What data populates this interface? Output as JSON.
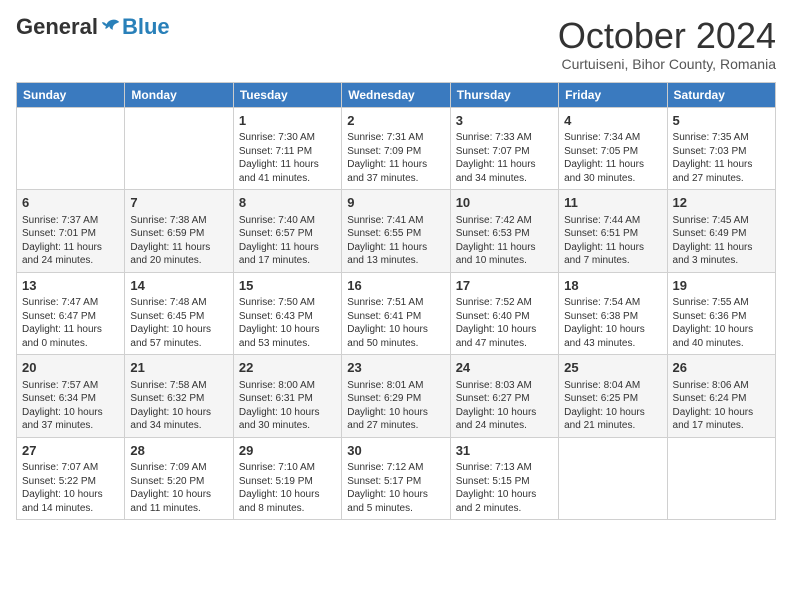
{
  "logo": {
    "general": "General",
    "blue": "Blue"
  },
  "header": {
    "month": "October 2024",
    "location": "Curtuiseni, Bihor County, Romania"
  },
  "days_of_week": [
    "Sunday",
    "Monday",
    "Tuesday",
    "Wednesday",
    "Thursday",
    "Friday",
    "Saturday"
  ],
  "weeks": [
    [
      {
        "day": "",
        "info": ""
      },
      {
        "day": "",
        "info": ""
      },
      {
        "day": "1",
        "info": "Sunrise: 7:30 AM\nSunset: 7:11 PM\nDaylight: 11 hours and 41 minutes."
      },
      {
        "day": "2",
        "info": "Sunrise: 7:31 AM\nSunset: 7:09 PM\nDaylight: 11 hours and 37 minutes."
      },
      {
        "day": "3",
        "info": "Sunrise: 7:33 AM\nSunset: 7:07 PM\nDaylight: 11 hours and 34 minutes."
      },
      {
        "day": "4",
        "info": "Sunrise: 7:34 AM\nSunset: 7:05 PM\nDaylight: 11 hours and 30 minutes."
      },
      {
        "day": "5",
        "info": "Sunrise: 7:35 AM\nSunset: 7:03 PM\nDaylight: 11 hours and 27 minutes."
      }
    ],
    [
      {
        "day": "6",
        "info": "Sunrise: 7:37 AM\nSunset: 7:01 PM\nDaylight: 11 hours and 24 minutes."
      },
      {
        "day": "7",
        "info": "Sunrise: 7:38 AM\nSunset: 6:59 PM\nDaylight: 11 hours and 20 minutes."
      },
      {
        "day": "8",
        "info": "Sunrise: 7:40 AM\nSunset: 6:57 PM\nDaylight: 11 hours and 17 minutes."
      },
      {
        "day": "9",
        "info": "Sunrise: 7:41 AM\nSunset: 6:55 PM\nDaylight: 11 hours and 13 minutes."
      },
      {
        "day": "10",
        "info": "Sunrise: 7:42 AM\nSunset: 6:53 PM\nDaylight: 11 hours and 10 minutes."
      },
      {
        "day": "11",
        "info": "Sunrise: 7:44 AM\nSunset: 6:51 PM\nDaylight: 11 hours and 7 minutes."
      },
      {
        "day": "12",
        "info": "Sunrise: 7:45 AM\nSunset: 6:49 PM\nDaylight: 11 hours and 3 minutes."
      }
    ],
    [
      {
        "day": "13",
        "info": "Sunrise: 7:47 AM\nSunset: 6:47 PM\nDaylight: 11 hours and 0 minutes."
      },
      {
        "day": "14",
        "info": "Sunrise: 7:48 AM\nSunset: 6:45 PM\nDaylight: 10 hours and 57 minutes."
      },
      {
        "day": "15",
        "info": "Sunrise: 7:50 AM\nSunset: 6:43 PM\nDaylight: 10 hours and 53 minutes."
      },
      {
        "day": "16",
        "info": "Sunrise: 7:51 AM\nSunset: 6:41 PM\nDaylight: 10 hours and 50 minutes."
      },
      {
        "day": "17",
        "info": "Sunrise: 7:52 AM\nSunset: 6:40 PM\nDaylight: 10 hours and 47 minutes."
      },
      {
        "day": "18",
        "info": "Sunrise: 7:54 AM\nSunset: 6:38 PM\nDaylight: 10 hours and 43 minutes."
      },
      {
        "day": "19",
        "info": "Sunrise: 7:55 AM\nSunset: 6:36 PM\nDaylight: 10 hours and 40 minutes."
      }
    ],
    [
      {
        "day": "20",
        "info": "Sunrise: 7:57 AM\nSunset: 6:34 PM\nDaylight: 10 hours and 37 minutes."
      },
      {
        "day": "21",
        "info": "Sunrise: 7:58 AM\nSunset: 6:32 PM\nDaylight: 10 hours and 34 minutes."
      },
      {
        "day": "22",
        "info": "Sunrise: 8:00 AM\nSunset: 6:31 PM\nDaylight: 10 hours and 30 minutes."
      },
      {
        "day": "23",
        "info": "Sunrise: 8:01 AM\nSunset: 6:29 PM\nDaylight: 10 hours and 27 minutes."
      },
      {
        "day": "24",
        "info": "Sunrise: 8:03 AM\nSunset: 6:27 PM\nDaylight: 10 hours and 24 minutes."
      },
      {
        "day": "25",
        "info": "Sunrise: 8:04 AM\nSunset: 6:25 PM\nDaylight: 10 hours and 21 minutes."
      },
      {
        "day": "26",
        "info": "Sunrise: 8:06 AM\nSunset: 6:24 PM\nDaylight: 10 hours and 17 minutes."
      }
    ],
    [
      {
        "day": "27",
        "info": "Sunrise: 7:07 AM\nSunset: 5:22 PM\nDaylight: 10 hours and 14 minutes."
      },
      {
        "day": "28",
        "info": "Sunrise: 7:09 AM\nSunset: 5:20 PM\nDaylight: 10 hours and 11 minutes."
      },
      {
        "day": "29",
        "info": "Sunrise: 7:10 AM\nSunset: 5:19 PM\nDaylight: 10 hours and 8 minutes."
      },
      {
        "day": "30",
        "info": "Sunrise: 7:12 AM\nSunset: 5:17 PM\nDaylight: 10 hours and 5 minutes."
      },
      {
        "day": "31",
        "info": "Sunrise: 7:13 AM\nSunset: 5:15 PM\nDaylight: 10 hours and 2 minutes."
      },
      {
        "day": "",
        "info": ""
      },
      {
        "day": "",
        "info": ""
      }
    ]
  ]
}
